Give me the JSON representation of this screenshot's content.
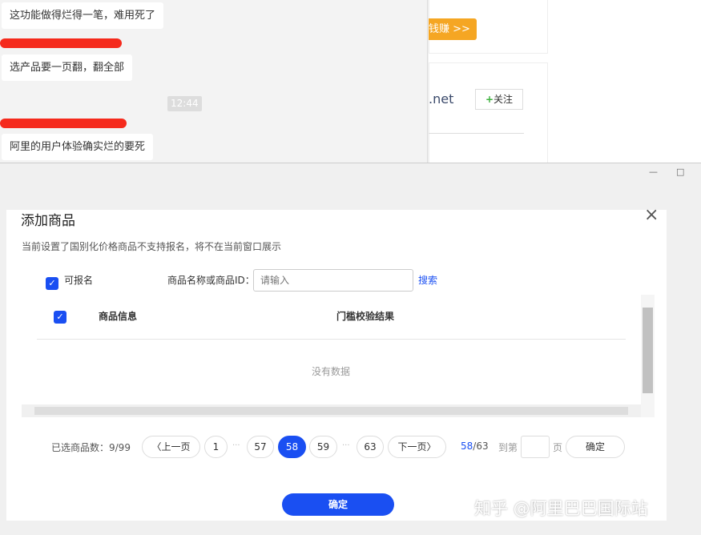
{
  "chat": {
    "messages": [
      "这功能做得烂得一笔，难用死了",
      "选产品要一页翻，翻全部",
      "阿里的用户体验确实烂的要死"
    ],
    "time": "12:44"
  },
  "right_panel": {
    "promo_button": "钱赚 >>",
    "domain_fragment": ".net",
    "follow_button": "关注",
    "follow_icon": "+"
  },
  "window": {
    "minimize_icon": "—",
    "maximize_icon": "□"
  },
  "dialog": {
    "title": "添加商品",
    "close_icon": "×",
    "notice": "当前设置了国别化价格商品不支持报名，将不在当前窗口展示",
    "filter": {
      "checkbox_label": "可报名",
      "checked": true,
      "search_label": "商品名称或商品ID：",
      "search_placeholder": "请输入",
      "search_button": "搜索"
    },
    "table": {
      "columns": [
        "商品信息",
        "门槛校验结果"
      ],
      "empty_text": "没有数据"
    },
    "pagination": {
      "selected_count": "已选商品数：9/99",
      "prev": "上一页",
      "next": "下一页",
      "pages": [
        "1",
        "57",
        "58",
        "59",
        "63"
      ],
      "current": "58",
      "total": "/63",
      "goto_label": "到第",
      "goto_suffix": "页",
      "goto_button": "确定"
    },
    "confirm_button": "确定"
  },
  "watermark": "知乎 @阿里巴巴国际站"
}
